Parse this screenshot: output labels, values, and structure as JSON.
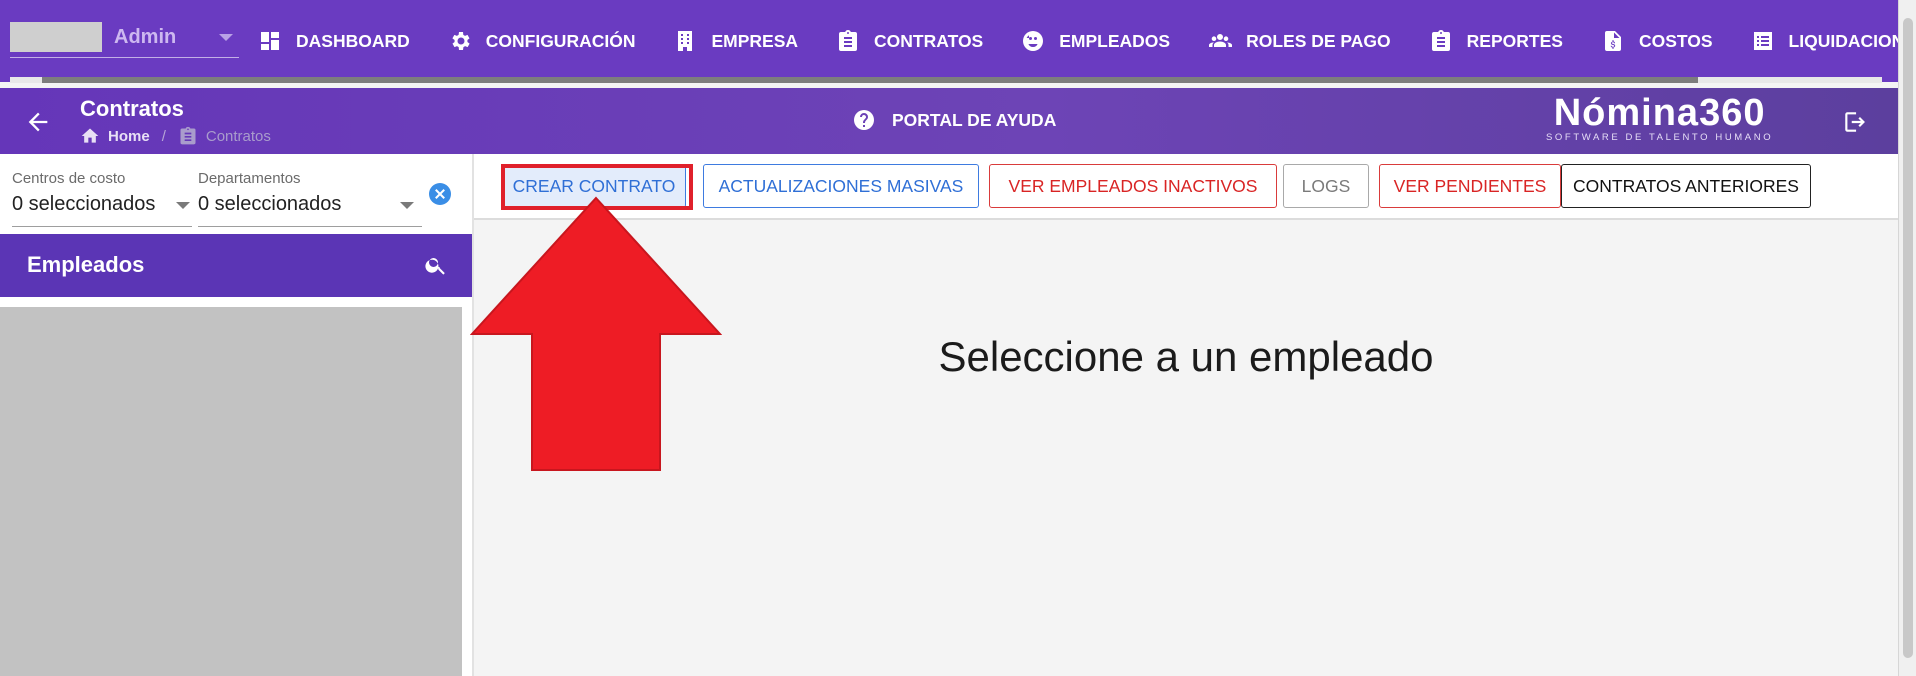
{
  "user": {
    "name": "Admin"
  },
  "nav": [
    {
      "label": "DASHBOARD",
      "icon": "dashboard-icon"
    },
    {
      "label": "CONFIGURACIÓN",
      "icon": "gear-icon"
    },
    {
      "label": "EMPRESA",
      "icon": "building-icon"
    },
    {
      "label": "CONTRATOS",
      "icon": "clipboard-icon"
    },
    {
      "label": "EMPLEADOS",
      "icon": "employees-icon"
    },
    {
      "label": "ROLES DE PAGO",
      "icon": "group-icon"
    },
    {
      "label": "REPORTES",
      "icon": "report-icon"
    },
    {
      "label": "COSTOS",
      "icon": "cost-file-icon"
    },
    {
      "label": "LIQUIDACIONES",
      "icon": "list-icon"
    }
  ],
  "subheader": {
    "title": "Contratos",
    "breadcrumb": {
      "home": "Home",
      "separator": "/",
      "current": "Contratos"
    },
    "help": "PORTAL DE AYUDA",
    "brand_name": "Nómina360",
    "brand_sub": "SOFTWARE DE TALENTO HUMANO"
  },
  "filters": {
    "cost_centers": {
      "label": "Centros de costo",
      "value": "0 seleccionados"
    },
    "departments": {
      "label": "Departamentos",
      "value": "0 seleccionados"
    }
  },
  "employees": {
    "title": "Empleados"
  },
  "actions": {
    "crear": "CREAR CONTRATO",
    "masivas": "ACTUALIZACIONES MASIVAS",
    "inactivos": "VER EMPLEADOS INACTIVOS",
    "logs": "LOGS",
    "pendientes": "VER PENDIENTES",
    "anteriores": "CONTRATOS ANTERIORES"
  },
  "main": {
    "message": "Seleccione a un empleado"
  },
  "colors": {
    "primary": "#6a3bc1",
    "panel": "#5b35b5",
    "blue": "#2f6fd6",
    "red": "#d92424",
    "annotation": "#e0202b"
  }
}
